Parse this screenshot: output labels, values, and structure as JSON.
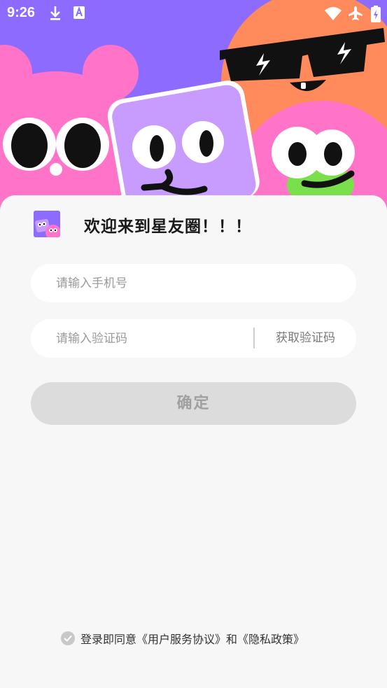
{
  "status_bar": {
    "time": "9:26",
    "icons": [
      "download-icon",
      "font-a-icon",
      "wifi-icon",
      "airplane-icon",
      "battery-charging-icon"
    ]
  },
  "colors": {
    "hero_bg": "#8d6bff",
    "character_pink": "#ff74c8",
    "character_lilac": "#c89cff",
    "character_orange": "#ff8a5c",
    "character_green": "#79e04b",
    "button_disabled": "#dcdcdc"
  },
  "welcome_text": "欢迎来到星友圈！！！",
  "phone_field": {
    "placeholder": "请输入手机号",
    "value": ""
  },
  "code_field": {
    "placeholder": "请输入验证码",
    "value": ""
  },
  "get_code_label": "获取验证码",
  "confirm_label": "确定",
  "agreement": {
    "prefix": "登录即同意",
    "user_agreement": "《用户服务协议》",
    "joiner": "和",
    "privacy_policy": "《隐私政策》"
  }
}
